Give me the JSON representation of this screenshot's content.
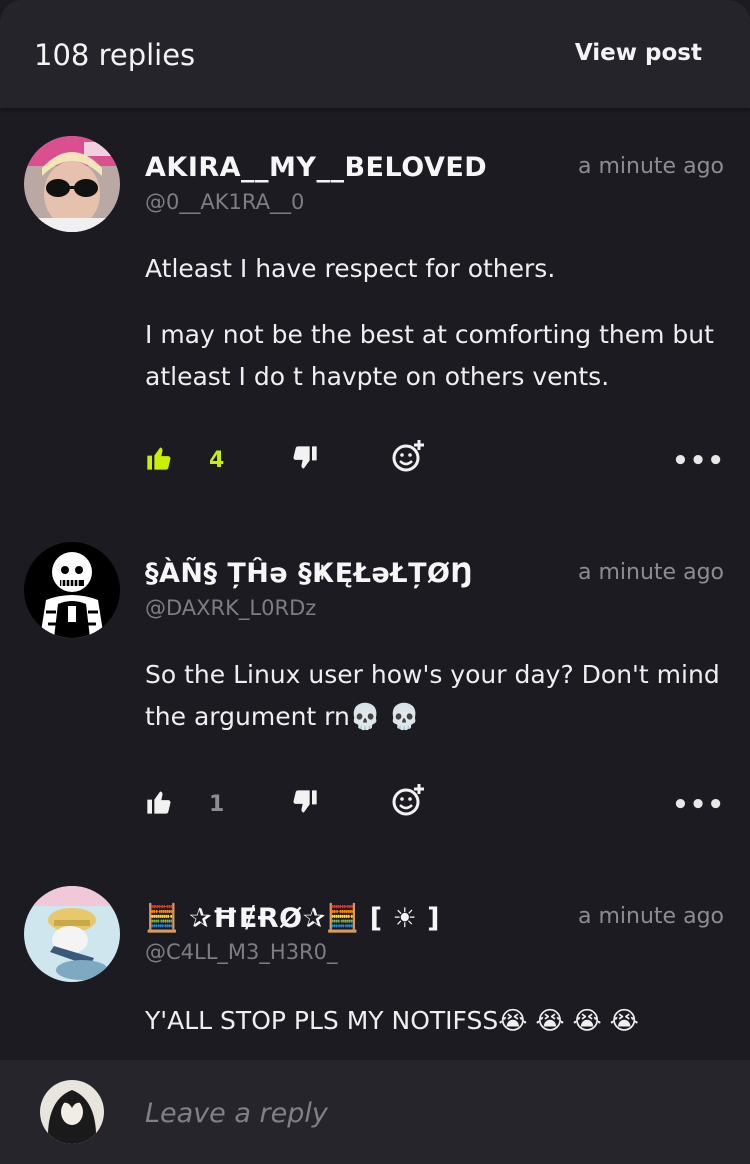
{
  "header": {
    "reply_count": "108 replies",
    "view_post": "View post"
  },
  "comments": [
    {
      "name": "AKIRA__MY__BELOVED",
      "handle": "@0__AK1RA__0",
      "time": "a minute ago",
      "paragraphs": [
        "Atleast I have respect for others.",
        "I may not be the best at comforting them but atleast I do t havpte on others vents."
      ],
      "likes": "4",
      "liked": true
    },
    {
      "name": "§ÀÑ§ ȚĤə §ҜĘŁəŁȚØŊ",
      "handle": "@DAXRK_L0RDz",
      "time": "a minute ago",
      "paragraphs": [
        "So the Linux user how's your day? Don't mind the argument rn💀 💀"
      ],
      "likes": "1",
      "liked": false
    },
    {
      "name": "🧮 ✰ĦɆɌØ✰🧮 [ ☀ ]",
      "handle": "@C4LL_M3_H3R0_",
      "time": "a minute ago",
      "paragraphs": [
        "Y'ALL STOP PLS MY NOTIFSS😭 😭 😭 😭"
      ]
    }
  ],
  "footer": {
    "reply_placeholder": "Leave a reply"
  },
  "colors": {
    "accent_like": "#c8f000",
    "background": "#1c1b22",
    "header": "#25242b"
  },
  "icons": [
    "thumbs-up-icon",
    "thumbs-down-icon",
    "add-reaction-icon",
    "more-icon"
  ]
}
